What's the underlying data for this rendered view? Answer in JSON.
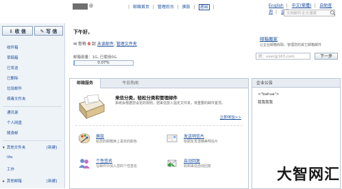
{
  "header": {
    "user_suffix": "@",
    "links": [
      "邮箱首页",
      "管理后台",
      "换肤",
      "退出"
    ],
    "lang_links": [
      "English",
      "中文(繁體)",
      "自助查询",
      "设置"
    ],
    "search_placeholder": "文档邮件全文搜索"
  },
  "sidebar": {
    "receive_label": "收 信",
    "write_label": "写 信",
    "folders": [
      "收件箱",
      "草稿箱",
      "已发送",
      "已删除",
      "垃圾邮件",
      "病毒文件夹"
    ],
    "tools": [
      "通讯录",
      "个人网盘",
      "随身邮"
    ],
    "other_folders_label": "其他文件夹",
    "other_folders_new": "[新建]",
    "other_folders_items": [
      "life",
      "工作"
    ],
    "other_mail_label": "其他邮箱",
    "other_mail_new": "[新建]"
  },
  "main": {
    "greeting": "下午好，",
    "status_prefix": "你有",
    "unread_count": "0",
    "status_mid": "封",
    "unread_link": "未读邮件",
    "manage_link": "管理文件夹",
    "storage_text": "邮箱容量：1G, 已使用0G",
    "storage_percent_label": "0.07%",
    "storage_percent": 0.07,
    "tab_active": "邮箱服务",
    "tab_other": "今日热闻",
    "feature_title": "来信分类，轻松分类和管理邮件",
    "feature_desc": "系统会根据您设定的规则，把来信放入指定文件夹，将重要的邮件置顶。",
    "feature_link": "立即体验>>",
    "services": [
      {
        "title": "换肤",
        "desc": "给您的邮箱换上喜欢的颜色"
      },
      {
        "title": "发送明信片",
        "desc": "给朋友发送精美明信片"
      },
      {
        "title": "个性签名",
        "desc": "在邮件中加入您的个性签名"
      },
      {
        "title": "自动回复",
        "desc": "收到来信自动回复"
      }
    ]
  },
  "right": {
    "title": "邮箱搬家",
    "desc": "让企业邮箱收取、管理您的其它邮箱邮件",
    "input_placeholder": "例：user@163.com",
    "next_button": "下一步",
    "notice_title": "企业公告",
    "notice_line1": "<\"bahua\">",
    "notice_line2": "我我我我"
  },
  "watermark": "大智网汇",
  "colors": {
    "link": "#1b4e9b",
    "sidebar_bg": "#eef3f8",
    "panel_tab_bg": "#e6ecf2",
    "progress_fill": "#5aa0de",
    "unread_count": "#cc0000"
  }
}
